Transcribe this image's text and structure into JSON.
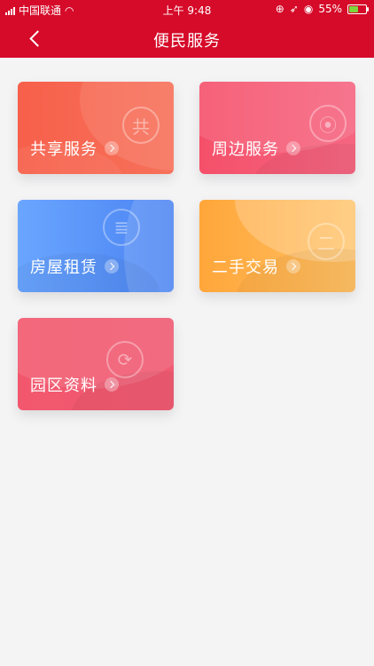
{
  "status_bar": {
    "carrier": "中国联通",
    "time": "上午 9:48",
    "battery": "55%"
  },
  "header": {
    "title": "便民服务",
    "back_icon": "chevron-left-icon"
  },
  "cards": [
    {
      "label": "共享服务",
      "emblem": "共"
    },
    {
      "label": "周边服务",
      "emblem": "⦿"
    },
    {
      "label": "房屋租赁",
      "emblem": "≣"
    },
    {
      "label": "二手交易",
      "emblem": "二"
    },
    {
      "label": "园区资料",
      "emblem": "⟳"
    }
  ],
  "colors": {
    "header": "#d60a29",
    "background": "#f4f4f5"
  }
}
